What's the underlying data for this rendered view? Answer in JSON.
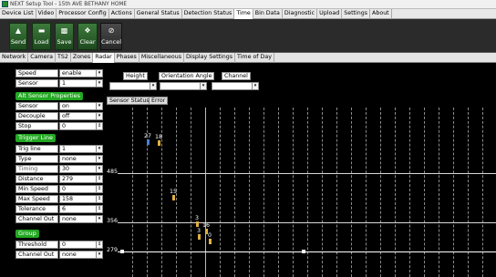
{
  "window": {
    "title": "NEXT Setup Tool - 15th AVE BETHANY HOME"
  },
  "menu": {
    "tabs": [
      "Device List",
      "Video",
      "Processor Config",
      "Actions",
      "General Status",
      "Detection Status",
      "Time",
      "Bin Data",
      "Diagnostic",
      "Upload",
      "Settings",
      "About"
    ],
    "active": "Time"
  },
  "toolbar": {
    "send_label": "Send",
    "load_label": "Load",
    "save_label": "Save",
    "clear_label": "Clear",
    "cancel_label": "Cancel"
  },
  "subtabs": {
    "tabs": [
      "Network",
      "Camera",
      "TS2",
      "Zones",
      "Radar",
      "Phases",
      "Miscellaneous",
      "Display Settings",
      "Time of Day"
    ],
    "active": "Radar"
  },
  "radar": {
    "speed_display_label": "Speed Display",
    "speed_display_value": "enable",
    "sensor_number_label": "Sensor Number",
    "sensor_number_value": "1",
    "height_label": "Height",
    "orientation_label": "Orientation Angle",
    "channel_label": "Channel",
    "height_value": "",
    "orientation_value": "",
    "channel_value": ""
  },
  "alt_sensor": {
    "title": "Alt Sensor Properties",
    "rows": [
      {
        "label": "Sensor",
        "value": "on"
      },
      {
        "label": "Decouple",
        "value": "off"
      },
      {
        "label": "Stop Distance",
        "value": "0"
      }
    ]
  },
  "trigger": {
    "title": "Trigger Line",
    "rows": [
      {
        "label": "Trig line",
        "value": "1"
      },
      {
        "label": "Type",
        "value": "none"
      },
      {
        "label": "Timing",
        "value": "30"
      },
      {
        "label": "Distance",
        "value": "279"
      },
      {
        "label": "Min Speed",
        "value": "0"
      },
      {
        "label": "Max Speed",
        "value": "158"
      },
      {
        "label": "Tolerance",
        "value": "6"
      },
      {
        "label": "Channel Out",
        "value": "none"
      }
    ]
  },
  "group": {
    "title": "Group",
    "rows": [
      {
        "label": "Threshold",
        "value": "0"
      },
      {
        "label": "Channel Out",
        "value": "none"
      }
    ]
  },
  "graph": {
    "status_label": "Sensor Status",
    "error_label": "Error",
    "lines": [
      "485",
      "356",
      "279"
    ],
    "vehicles": [
      {
        "label": "27",
        "color": "#4a7fd8"
      },
      {
        "label": "18",
        "color": "#e0b040"
      },
      {
        "label": "15",
        "color": "#e0b040"
      },
      {
        "label": "3",
        "color": "#e0b040"
      },
      {
        "label": "16",
        "color": "#e0b040"
      },
      {
        "label": "3",
        "color": "#e0b040"
      },
      {
        "label": "0",
        "color": "#e0b040"
      }
    ]
  }
}
